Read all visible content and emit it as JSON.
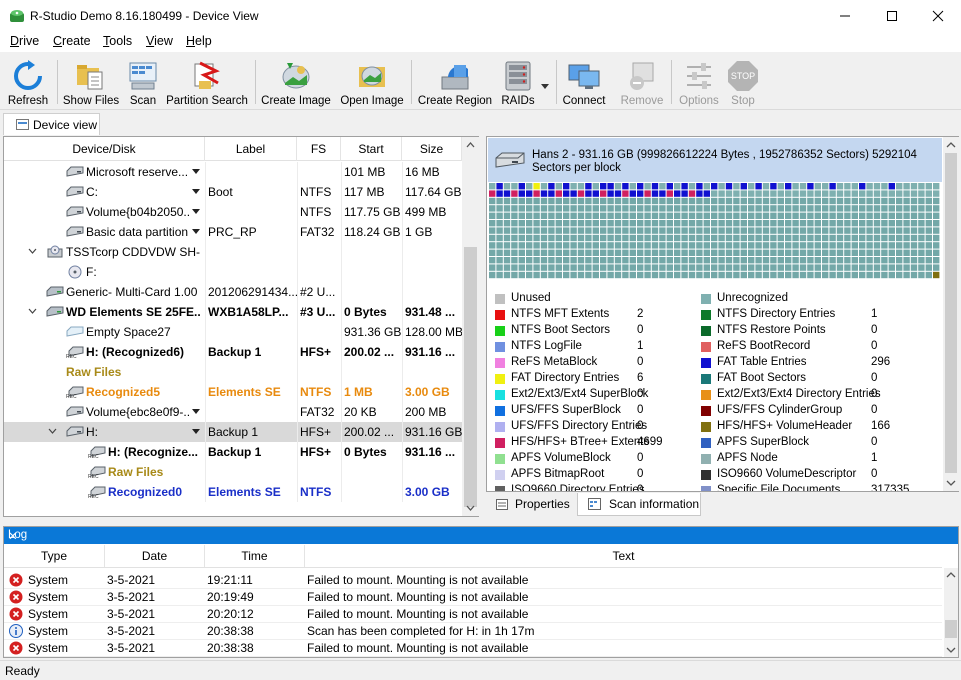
{
  "window": {
    "title": "R-Studio Demo 8.16.180499 - Device View"
  },
  "menu": [
    {
      "label": "Drive",
      "ul": "D",
      "rest": "rive"
    },
    {
      "label": "Create",
      "ul": "C",
      "rest": "reate"
    },
    {
      "label": "Tools",
      "ul": "T",
      "rest": "ools"
    },
    {
      "label": "View",
      "ul": "V",
      "rest": "iew"
    },
    {
      "label": "Help",
      "ul": "H",
      "rest": "elp"
    }
  ],
  "toolbar": {
    "refresh": "Refresh",
    "show_files": "Show Files",
    "scan": "Scan",
    "partition_search": "Partition Search",
    "create_image": "Create Image",
    "open_image": "Open Image",
    "create_region": "Create Region",
    "raids": "RAIDs",
    "connect": "Connect",
    "remove": "Remove",
    "options": "Options",
    "stop": "Stop",
    "stop_icon_text": "STOP"
  },
  "device_view_tab": "Device view",
  "tree": {
    "columns": [
      "Device/Disk",
      "Label",
      "FS",
      "Start",
      "Size"
    ],
    "rows": [
      {
        "name": "Microsoft reserve...",
        "label": "",
        "fs": "",
        "start": "101 MB",
        "size": "16 MB",
        "indent": 62,
        "icon": "volume",
        "dd": true
      },
      {
        "name": "C:",
        "label": "Boot",
        "fs": "NTFS",
        "start": "117 MB",
        "size": "117.64 GB",
        "indent": 62,
        "icon": "volume",
        "dd": true
      },
      {
        "name": "Volume{b04b2050...",
        "label": "",
        "fs": "NTFS",
        "start": "117.75 GB",
        "size": "499 MB",
        "indent": 62,
        "icon": "volume",
        "dd": true
      },
      {
        "name": "Basic data partition",
        "label": "PRC_RP",
        "fs": "FAT32",
        "start": "118.24 GB",
        "size": "1 GB",
        "indent": 62,
        "icon": "volume",
        "dd": true
      },
      {
        "name": "TSSTcorp CDDVDW SH-...",
        "label": "",
        "fs": "",
        "start": "",
        "size": "",
        "indent": 42,
        "icon": "cdrom",
        "expander": "open"
      },
      {
        "name": "F:",
        "label": "",
        "fs": "",
        "start": "",
        "size": "",
        "indent": 62,
        "icon": "cdvol"
      },
      {
        "name": "Generic- Multi-Card 1.00",
        "label": "201206291434...",
        "fs": "#2 U...",
        "start": "",
        "size": "",
        "indent": 42,
        "icon": "drive"
      },
      {
        "name": "WD Elements SE 25FE...",
        "label": "WXB1A58LP...",
        "fs": "#3 U...",
        "start": "0 Bytes",
        "size": "931.48 ...",
        "indent": 42,
        "icon": "drive",
        "expander": "open",
        "style": "bold"
      },
      {
        "name": "Empty Space27",
        "label": "",
        "fs": "",
        "start": "931.36 GB",
        "size": "128.00 MB",
        "indent": 62,
        "icon": "empty"
      },
      {
        "name": "H: (Recognized6)",
        "label": "Backup 1",
        "fs": "HFS+",
        "start": "200.02 ...",
        "size": "931.16 ...",
        "indent": 62,
        "icon": "rec",
        "style": "bold"
      },
      {
        "name": "Raw Files",
        "label": "",
        "fs": "",
        "start": "",
        "size": "",
        "indent": 62,
        "icon": "none",
        "style": "gold"
      },
      {
        "name": "Recognized5",
        "label": "Elements SE",
        "fs": "NTFS",
        "start": "1 MB",
        "size": "3.00 GB",
        "indent": 62,
        "icon": "rec",
        "style": "orange"
      },
      {
        "name": "Volume{ebc8e0f9-...",
        "label": "",
        "fs": "FAT32",
        "start": "20 KB",
        "size": "200 MB",
        "indent": 62,
        "icon": "volume",
        "dd": true
      },
      {
        "name": "H:",
        "label": "Backup 1",
        "fs": "HFS+",
        "start": "200.02 ...",
        "size": "931.16 GB",
        "indent": 62,
        "icon": "volume",
        "dd": true,
        "expander": "open",
        "selected": true
      },
      {
        "name": "H: (Recognize...",
        "label": "Backup 1",
        "fs": "HFS+",
        "start": "0 Bytes",
        "size": "931.16 ...",
        "indent": 84,
        "icon": "rec",
        "style": "bold"
      },
      {
        "name": "Raw Files",
        "label": "",
        "fs": "",
        "start": "",
        "size": "",
        "indent": 84,
        "icon": "rec",
        "style": "gold"
      },
      {
        "name": "Recognized0",
        "label": "Elements SE",
        "fs": "NTFS",
        "start": "",
        "size": "3.00 GB",
        "indent": 84,
        "icon": "rec",
        "style": "blue"
      }
    ]
  },
  "disk_header": "Hans 2 - 931.16 GB (999826612224 Bytes , 1952786352 Sectors) 5292104 Sectors per block",
  "legend": [
    {
      "name": "Unused",
      "count": "",
      "color": "#c0c0c0"
    },
    {
      "name": "Unrecognized",
      "count": "",
      "color": "#7fb0b0"
    },
    {
      "name": "NTFS MFT Extents",
      "count": "2",
      "color": "#e81010"
    },
    {
      "name": "NTFS Directory Entries",
      "count": "1",
      "color": "#0e7a2a"
    },
    {
      "name": "NTFS Boot Sectors",
      "count": "0",
      "color": "#18d018"
    },
    {
      "name": "NTFS Restore Points",
      "count": "0",
      "color": "#0b6a2a"
    },
    {
      "name": "NTFS LogFile",
      "count": "1",
      "color": "#7090e0"
    },
    {
      "name": "ReFS BootRecord",
      "count": "0",
      "color": "#e06060"
    },
    {
      "name": "ReFS MetaBlock",
      "count": "0",
      "color": "#f080e0"
    },
    {
      "name": "FAT Table Entries",
      "count": "296",
      "color": "#1010d0"
    },
    {
      "name": "FAT Directory Entries",
      "count": "6",
      "color": "#f0f010"
    },
    {
      "name": "FAT Boot Sectors",
      "count": "0",
      "color": "#1a7878"
    },
    {
      "name": "Ext2/Ext3/Ext4 SuperBlock",
      "count": "0",
      "color": "#18e0e0"
    },
    {
      "name": "Ext2/Ext3/Ext4 Directory Entries",
      "count": "0",
      "color": "#e89018"
    },
    {
      "name": "UFS/FFS SuperBlock",
      "count": "0",
      "color": "#1070e0"
    },
    {
      "name": "UFS/FFS CylinderGroup",
      "count": "0",
      "color": "#800000"
    },
    {
      "name": "UFS/FFS Directory Entries",
      "count": "0",
      "color": "#b0b0f0"
    },
    {
      "name": "HFS/HFS+ VolumeHeader",
      "count": "166",
      "color": "#807010"
    },
    {
      "name": "HFS/HFS+ BTree+ Extents",
      "count": "4699",
      "color": "#d02060"
    },
    {
      "name": "APFS SuperBlock",
      "count": "0",
      "color": "#3060c0"
    },
    {
      "name": "APFS VolumeBlock",
      "count": "0",
      "color": "#90e090"
    },
    {
      "name": "APFS Node",
      "count": "1",
      "color": "#90b0b0"
    },
    {
      "name": "APFS BitmapRoot",
      "count": "0",
      "color": "#d0d0f0"
    },
    {
      "name": "ISO9660 VolumeDescriptor",
      "count": "0",
      "color": "#303030"
    },
    {
      "name": "ISO9660 Directory Entries",
      "count": "0",
      "color": "#606060"
    },
    {
      "name": "Specific File Documents",
      "count": "317335",
      "color": "#8090c8"
    }
  ],
  "right_tabs": {
    "properties": "Properties",
    "scan_information": "Scan information"
  },
  "log": {
    "title": "Log",
    "columns": [
      "Type",
      "Date",
      "Time",
      "Text"
    ],
    "rows": [
      {
        "type": "System",
        "date": "3-5-2021",
        "time": "19:21:11",
        "text": "Failed to mount. Mounting is not available",
        "kind": "error"
      },
      {
        "type": "System",
        "date": "3-5-2021",
        "time": "20:19:49",
        "text": "Failed to mount. Mounting is not available",
        "kind": "error"
      },
      {
        "type": "System",
        "date": "3-5-2021",
        "time": "20:20:12",
        "text": "Failed to mount. Mounting is not available",
        "kind": "error"
      },
      {
        "type": "System",
        "date": "3-5-2021",
        "time": "20:38:38",
        "text": "Scan has been completed for H: in 1h 17m",
        "kind": "info"
      },
      {
        "type": "System",
        "date": "3-5-2021",
        "time": "20:38:38",
        "text": "Failed to mount. Mounting is not available",
        "kind": "error"
      }
    ]
  },
  "status": "Ready",
  "colors": {
    "accent": "#0a78d7",
    "disk_header_bg": "#c4d7f0",
    "grid_cell": "#73a8a8",
    "selected_row": "#d9d9d9"
  }
}
